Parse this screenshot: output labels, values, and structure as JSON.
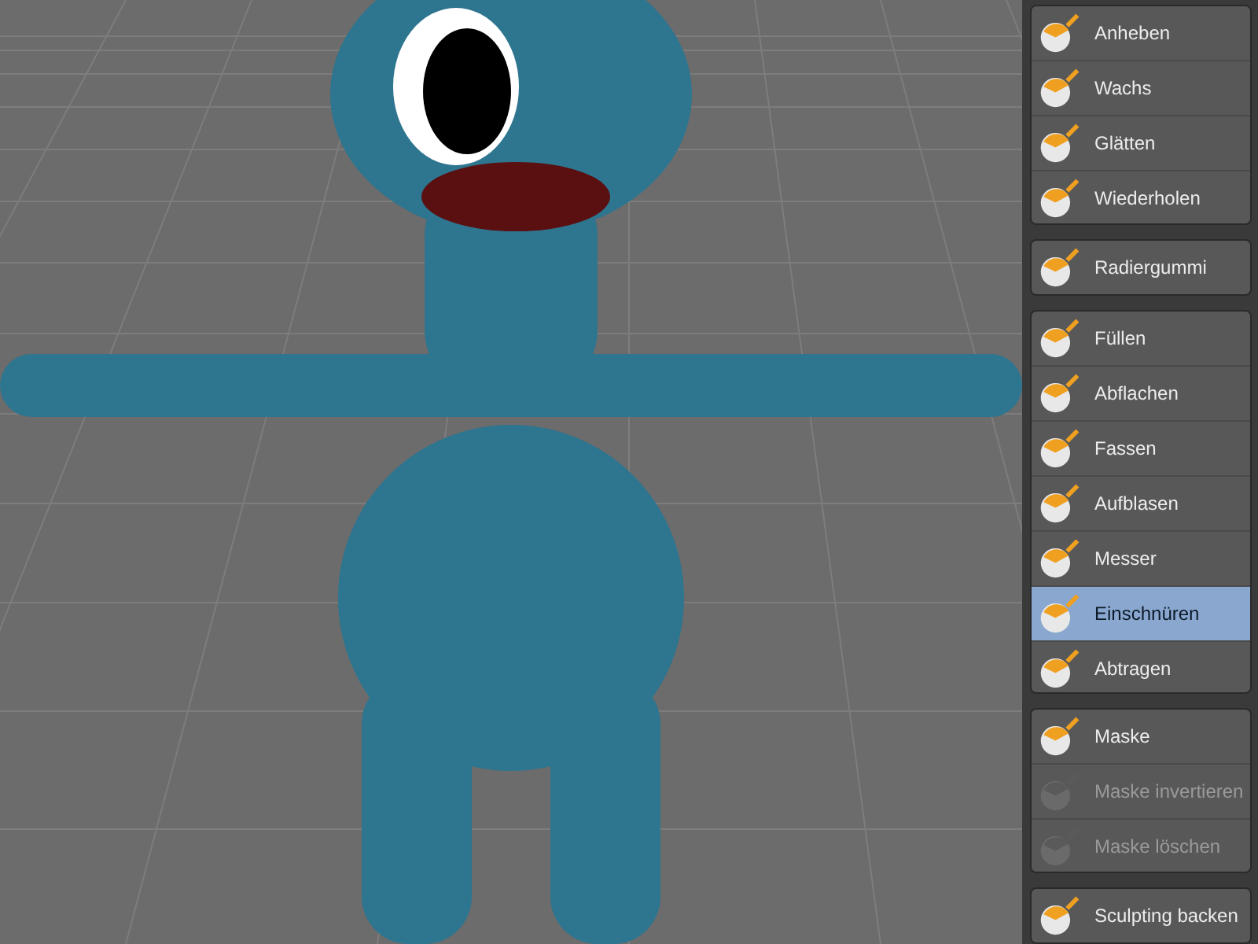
{
  "viewport": {
    "kind": "render"
  },
  "tool_groups": [
    {
      "tools": [
        {
          "label": "Anheben",
          "selected": false,
          "disabled": false
        },
        {
          "label": "Wachs",
          "selected": false,
          "disabled": false
        },
        {
          "label": "Glätten",
          "selected": false,
          "disabled": false
        },
        {
          "label": "Wiederholen",
          "selected": false,
          "disabled": false
        }
      ]
    },
    {
      "tools": [
        {
          "label": "Radiergummi",
          "selected": false,
          "disabled": false
        }
      ]
    },
    {
      "tools": [
        {
          "label": "Füllen",
          "selected": false,
          "disabled": false
        },
        {
          "label": "Abflachen",
          "selected": false,
          "disabled": false
        },
        {
          "label": "Fassen",
          "selected": false,
          "disabled": false
        },
        {
          "label": "Aufblasen",
          "selected": false,
          "disabled": false
        },
        {
          "label": "Messer",
          "selected": false,
          "disabled": false
        },
        {
          "label": "Einschnüren",
          "selected": true,
          "disabled": false
        },
        {
          "label": "Abtragen",
          "selected": false,
          "disabled": false
        }
      ]
    },
    {
      "tools": [
        {
          "label": "Maske",
          "selected": false,
          "disabled": false
        },
        {
          "label": "Maske invertieren",
          "selected": false,
          "disabled": true
        },
        {
          "label": "Maske löschen",
          "selected": false,
          "disabled": true
        }
      ]
    },
    {
      "tools": [
        {
          "label": "Sculpting backen",
          "selected": false,
          "disabled": false
        }
      ]
    }
  ]
}
